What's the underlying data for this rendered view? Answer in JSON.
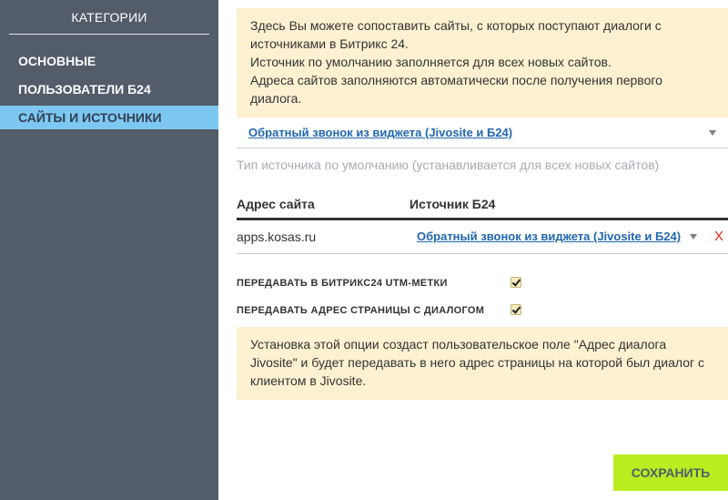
{
  "sidebar": {
    "title": "КАТЕГОРИИ",
    "items": [
      {
        "label": "ОСНОВНЫЕ",
        "active": false
      },
      {
        "label": "ПОЛЬЗОВАТЕЛИ Б24",
        "active": false
      },
      {
        "label": "САЙТЫ И ИСТОЧНИКИ",
        "active": true
      }
    ]
  },
  "info_top": {
    "lines": [
      "Здесь Вы можете сопоставить сайты, с которых поступают диалоги с источниками в Битрикс 24.",
      "Источник по умолчанию заполняется для всех новых сайтов.",
      "Адреса сайтов заполняются автоматически после получения первого диалога."
    ]
  },
  "default_source": {
    "value": "Обратный звонок из виджета (Jivosite и Б24)",
    "hint": "Тип источника по умолчанию (устанавливается для всех новых сайтов)"
  },
  "table": {
    "headers": {
      "site": "Адрес сайта",
      "source": "Источник Б24"
    },
    "rows": [
      {
        "site": "apps.kosas.ru",
        "source": "Обратный звонок из виджета (Jivosite и Б24)",
        "remove": "X"
      }
    ]
  },
  "options": {
    "utm": {
      "label": "ПЕРЕДАВАТЬ В БИТРИКС24 UTM-МЕТКИ",
      "checked": true
    },
    "page_address": {
      "label": "ПЕРЕДАВАТЬ АДРЕС СТРАНИЦЫ С ДИАЛОГОМ",
      "checked": true
    }
  },
  "info_bottom": {
    "text": "Установка этой опции создаст пользовательское поле \"Адрес диалога Jivosite\" и будет передавать в него адрес страницы на которой был диалог с клиентом в Jivosite."
  },
  "save_label": "СОХРАНИТЬ",
  "colors": {
    "sidebar_bg": "#535c69",
    "active_item": "#7dc7f3",
    "info_bg": "#fdf1d1",
    "link": "#2067b0",
    "save_button": "#bbed21",
    "remove": "#e0251b"
  }
}
